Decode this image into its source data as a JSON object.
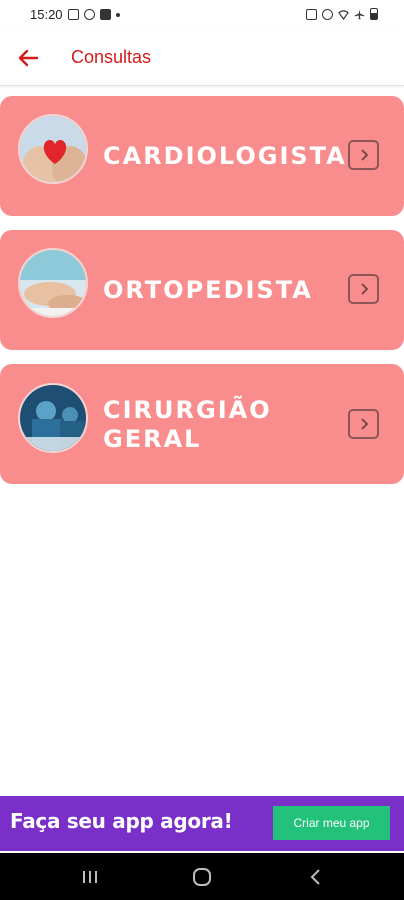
{
  "status_bar": {
    "time": "15:20",
    "left_icons": [
      "image-icon",
      "sync-icon",
      "youtube-icon",
      "dot-icon"
    ],
    "right_icons": [
      "nfc-icon",
      "alarm-icon",
      "wifi-icon",
      "airplane-icon",
      "battery-icon"
    ]
  },
  "app_bar": {
    "back_icon": "arrow-left-icon",
    "title": "Consultas"
  },
  "specialties": [
    {
      "label": "CARDIOLOGISTA",
      "image": "heart-in-hands-photo",
      "arrow_icon": "chevron-right-icon"
    },
    {
      "label": "ORTOPEDISTA",
      "image": "orthopedic-exam-photo",
      "arrow_icon": "chevron-right-icon"
    },
    {
      "label": "CIRURGIÃO\nGERAL",
      "image": "surgery-room-photo",
      "arrow_icon": "chevron-right-icon"
    }
  ],
  "banner": {
    "text": "Faça seu app agora!",
    "button_label": "Criar meu app"
  },
  "nav_bar": {
    "recents_icon": "recents-icon",
    "home_icon": "home-icon",
    "back_icon": "back-chevron-icon"
  },
  "colors": {
    "accent": "#d41b1b",
    "card_background": "#f98d8d",
    "banner_background": "#7a2fc8",
    "banner_button": "#22c27a"
  }
}
